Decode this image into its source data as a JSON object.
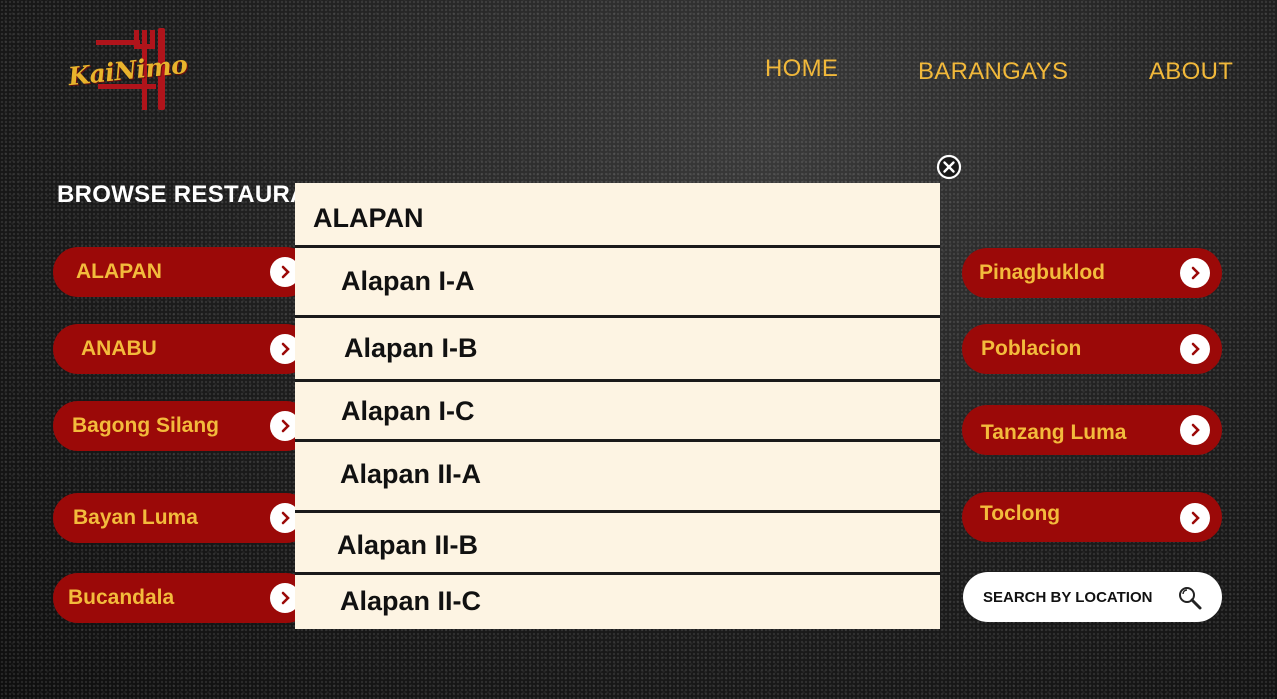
{
  "header": {
    "logo_text": "KaiNimo",
    "nav": [
      "HOME",
      "BARANGAYS",
      "ABOUT"
    ]
  },
  "browse": {
    "title": "BROWSE RESTAURANTS"
  },
  "left_barangays": [
    "ALAPAN",
    "ANABU",
    "Bagong Silang",
    "Bayan Luma",
    "Bucandala"
  ],
  "right_barangays": [
    "Pinagbuklod",
    "Poblacion",
    "Tanzang Luma",
    "Toclong"
  ],
  "search": {
    "label": "SEARCH BY LOCATION",
    "icon": "search-icon"
  },
  "modal": {
    "title": "ALAPAN",
    "items": [
      "Alapan I-A",
      "Alapan I-B",
      "Alapan I-C",
      "Alapan II-A",
      "Alapan II-B",
      "Alapan II-C"
    ],
    "close_icon": "close-icon"
  },
  "colors": {
    "accent": "#f1b83a",
    "pill_bg": "#9b0908",
    "modal_bg": "#fdf4e3",
    "background": "#141414"
  }
}
